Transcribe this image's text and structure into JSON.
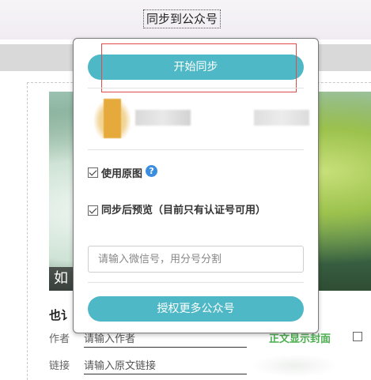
{
  "header": {
    "sync_link": "同步到公众号"
  },
  "popup": {
    "start_button": "开始同步",
    "use_original_image": "使用原图",
    "help_glyph": "?",
    "preview_after_sync": "同步后预览（目前只有认证号可用）",
    "wechat_input_placeholder": "请输入微信号，用分号分割",
    "authorize_button": "授权更多公众号"
  },
  "editor": {
    "cover_caption": "如",
    "subtitle": "也讠",
    "author_label": "作者",
    "author_placeholder": "请输入作者",
    "cover_toggle_label": "正文显示封面",
    "link_label": "链接",
    "link_placeholder": "请输入原文链接"
  },
  "colors": {
    "accent_teal": "#4fb8c6",
    "highlight_red": "#e34a4a",
    "help_blue": "#3b8de0",
    "cover_green": "#4caf50"
  }
}
